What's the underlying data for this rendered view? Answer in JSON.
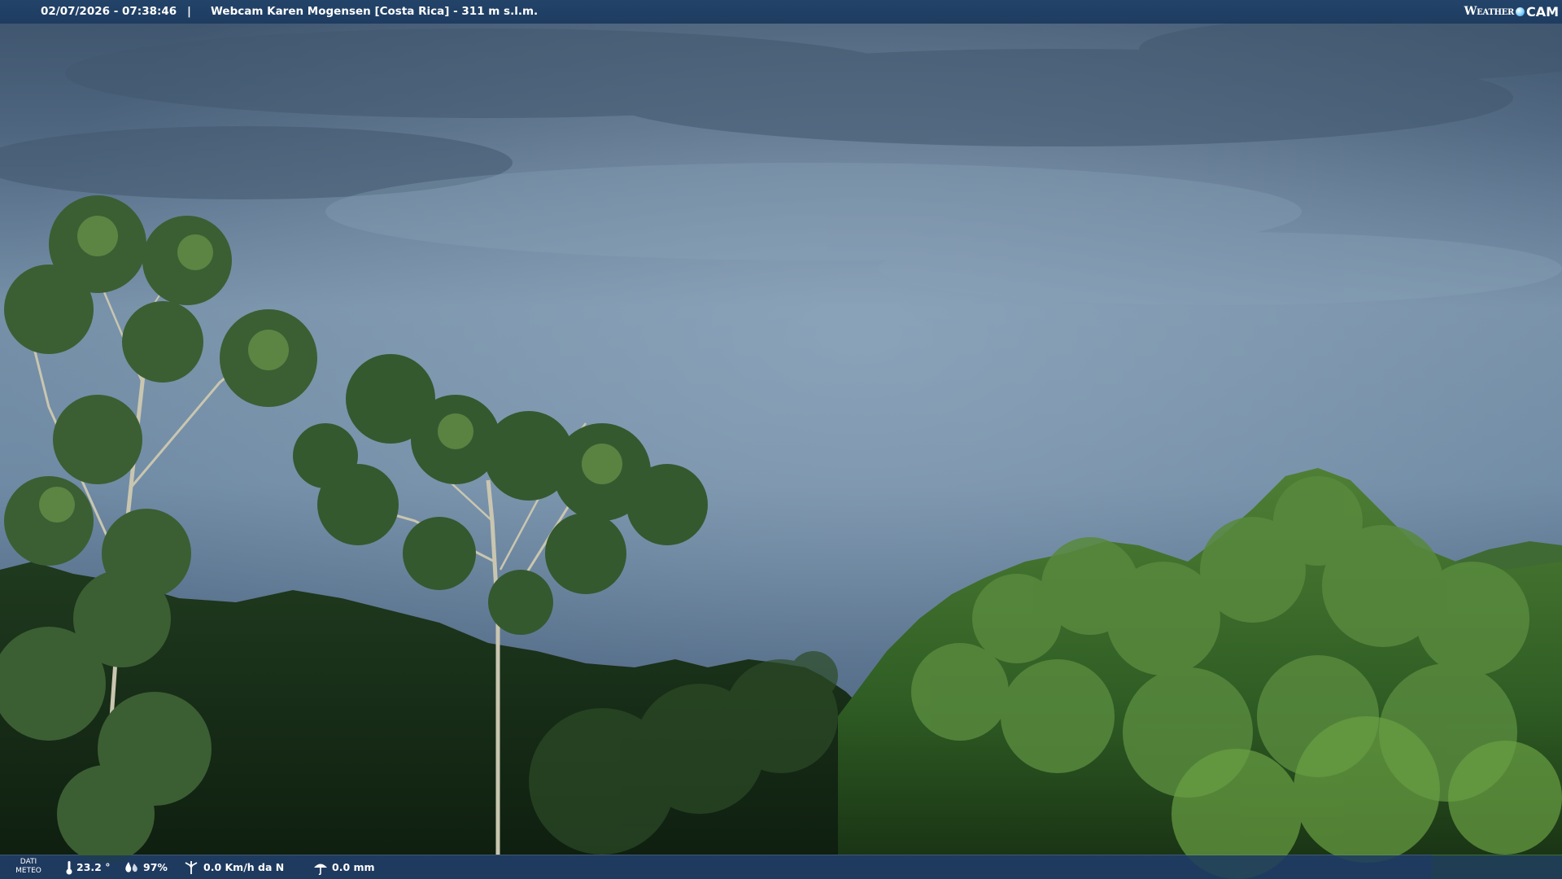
{
  "header": {
    "datetime": "02/07/2026 - 07:38:46",
    "separator": "|",
    "title": "Webcam Karen Mogensen [Costa Rica]  - 311 m s.l.m."
  },
  "brand": {
    "weather": "Weather",
    "cam": "CAM"
  },
  "footer": {
    "label_line1": "DATI",
    "label_line2": "METEO",
    "temperature": "23.2 °",
    "humidity": "97%",
    "wind": "0.0 Km/h da N",
    "rain": "0.0 mm"
  },
  "icons": {
    "temperature": "thermometer-icon",
    "humidity": "humidity-drop-icon",
    "wind": "wind-icon",
    "rain": "rain-icon",
    "brand": "globe-icon"
  },
  "colors": {
    "bar": "#1e3c60",
    "sky": "#6f87a0",
    "foliage": "#2f5a2a"
  }
}
